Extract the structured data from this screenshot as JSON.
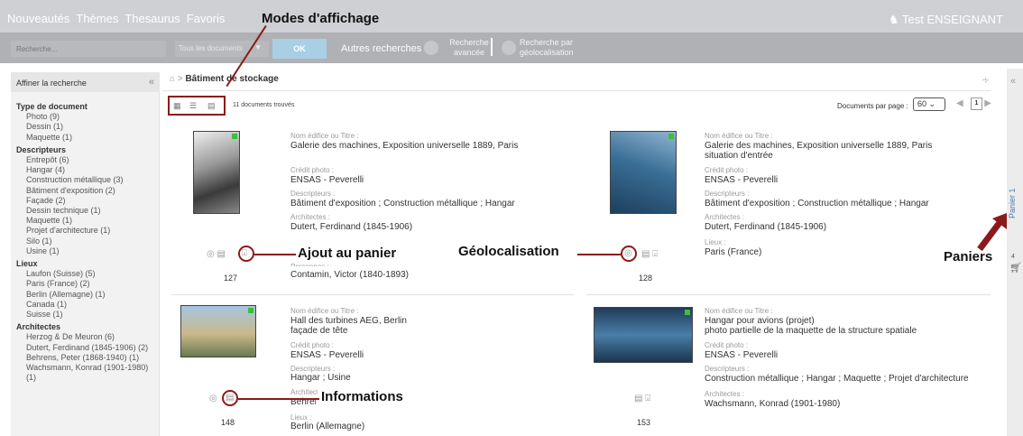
{
  "nav": {
    "items": [
      "Nouveautés",
      "Thèmes",
      "Thesaurus",
      "Favoris"
    ],
    "user": "Test ENSEIGNANT"
  },
  "search": {
    "placeholder": "Recherche...",
    "scope": "Tous les documents",
    "ok": "OK",
    "other_label": "Autres recherches :",
    "advanced": "Recherche avancée",
    "geo": "Recherche par géolocalisation"
  },
  "sidebar": {
    "title": "Affiner la recherche",
    "facets": [
      {
        "title": "Type de document",
        "items": [
          "Photo (9)",
          "Dessin (1)",
          "Maquette (1)"
        ]
      },
      {
        "title": "Descripteurs",
        "items": [
          "Entrepôt (6)",
          "Hangar (4)",
          "Construction métallique (3)",
          "Bâtiment d'exposition (2)",
          "Façade (2)",
          "Dessin technique (1)",
          "Maquette (1)",
          "Projet d'architecture (1)",
          "Silo (1)",
          "Usine (1)"
        ]
      },
      {
        "title": "Lieux",
        "items": [
          "Laufon (Suisse) (5)",
          "Paris (France) (2)",
          "Berlin (Allemagne) (1)",
          "Canada (1)",
          "Suisse (1)"
        ]
      },
      {
        "title": "Architectes",
        "items": [
          "Herzog & De Meuron (6)",
          "Dutert, Ferdinand (1845-1906) (2)",
          "Behrens, Peter (1868-1940) (1)",
          "Wachsmann, Konrad (1901-1980) (1)"
        ]
      }
    ]
  },
  "main": {
    "breadcrumb": "Bâtiment de stockage",
    "found": "11 documents trouvés",
    "per_page_label": "Documents par page :",
    "per_page_value": "60",
    "page": "1"
  },
  "basket": {
    "label": "Panier 1",
    "count": "4"
  },
  "labels": {
    "title": "Nom édifice ou Titre :",
    "credit": "Crédit photo :",
    "descriptors": "Descripteurs :",
    "architects": "Architectes :",
    "places": "Lieux :",
    "persons": "Personnes :"
  },
  "cards": [
    {
      "num": "127",
      "title": "Galerie des machines, Exposition universelle 1889, Paris",
      "credit": "ENSAS - Peverelli",
      "descriptors": "Bâtiment d'exposition ; Construction métallique ; Hangar",
      "architects": "Dutert, Ferdinand (1845-1906)",
      "persons": "Contamin, Victor (1840-1893)"
    },
    {
      "num": "128",
      "title": "Galerie des machines, Exposition universelle 1889, Paris",
      "title2": "situation d'entrée",
      "credit": "ENSAS - Peverelli",
      "descriptors": "Bâtiment d'exposition ; Construction métallique ; Hangar",
      "architects": "Dutert, Ferdinand (1845-1906)",
      "places": "Paris (France)"
    },
    {
      "num": "148",
      "title": "Hall des turbines AEG, Berlin",
      "title2": "façade de tête",
      "credit": "ENSAS - Peverelli",
      "descriptors": "Hangar ; Usine",
      "architects": "Behrens, Peter (1868-1940)",
      "places": "Berlin (Allemagne)"
    },
    {
      "num": "153",
      "title": "Hangar pour avions (projet)",
      "title2": "photo partielle de la maquette de la structure spatiale",
      "credit": "ENSAS - Peverelli",
      "descriptors": "Construction métallique ; Hangar ; Maquette ; Projet d'architecture",
      "architects": "Wachsmann, Konrad (1901-1980)"
    }
  ],
  "annotations": {
    "view_modes": "Modes d'affichage",
    "add_basket": "Ajout au panier",
    "geoloc": "Géolocalisation",
    "baskets": "Paniers",
    "info": "Informations"
  },
  "colors": {
    "accent": "#8b1a1a",
    "link": "#4c7ab1",
    "nav_bg": "#cfd0d3",
    "search_bg": "#b0b1b5",
    "badge": "#3cbf3c"
  }
}
